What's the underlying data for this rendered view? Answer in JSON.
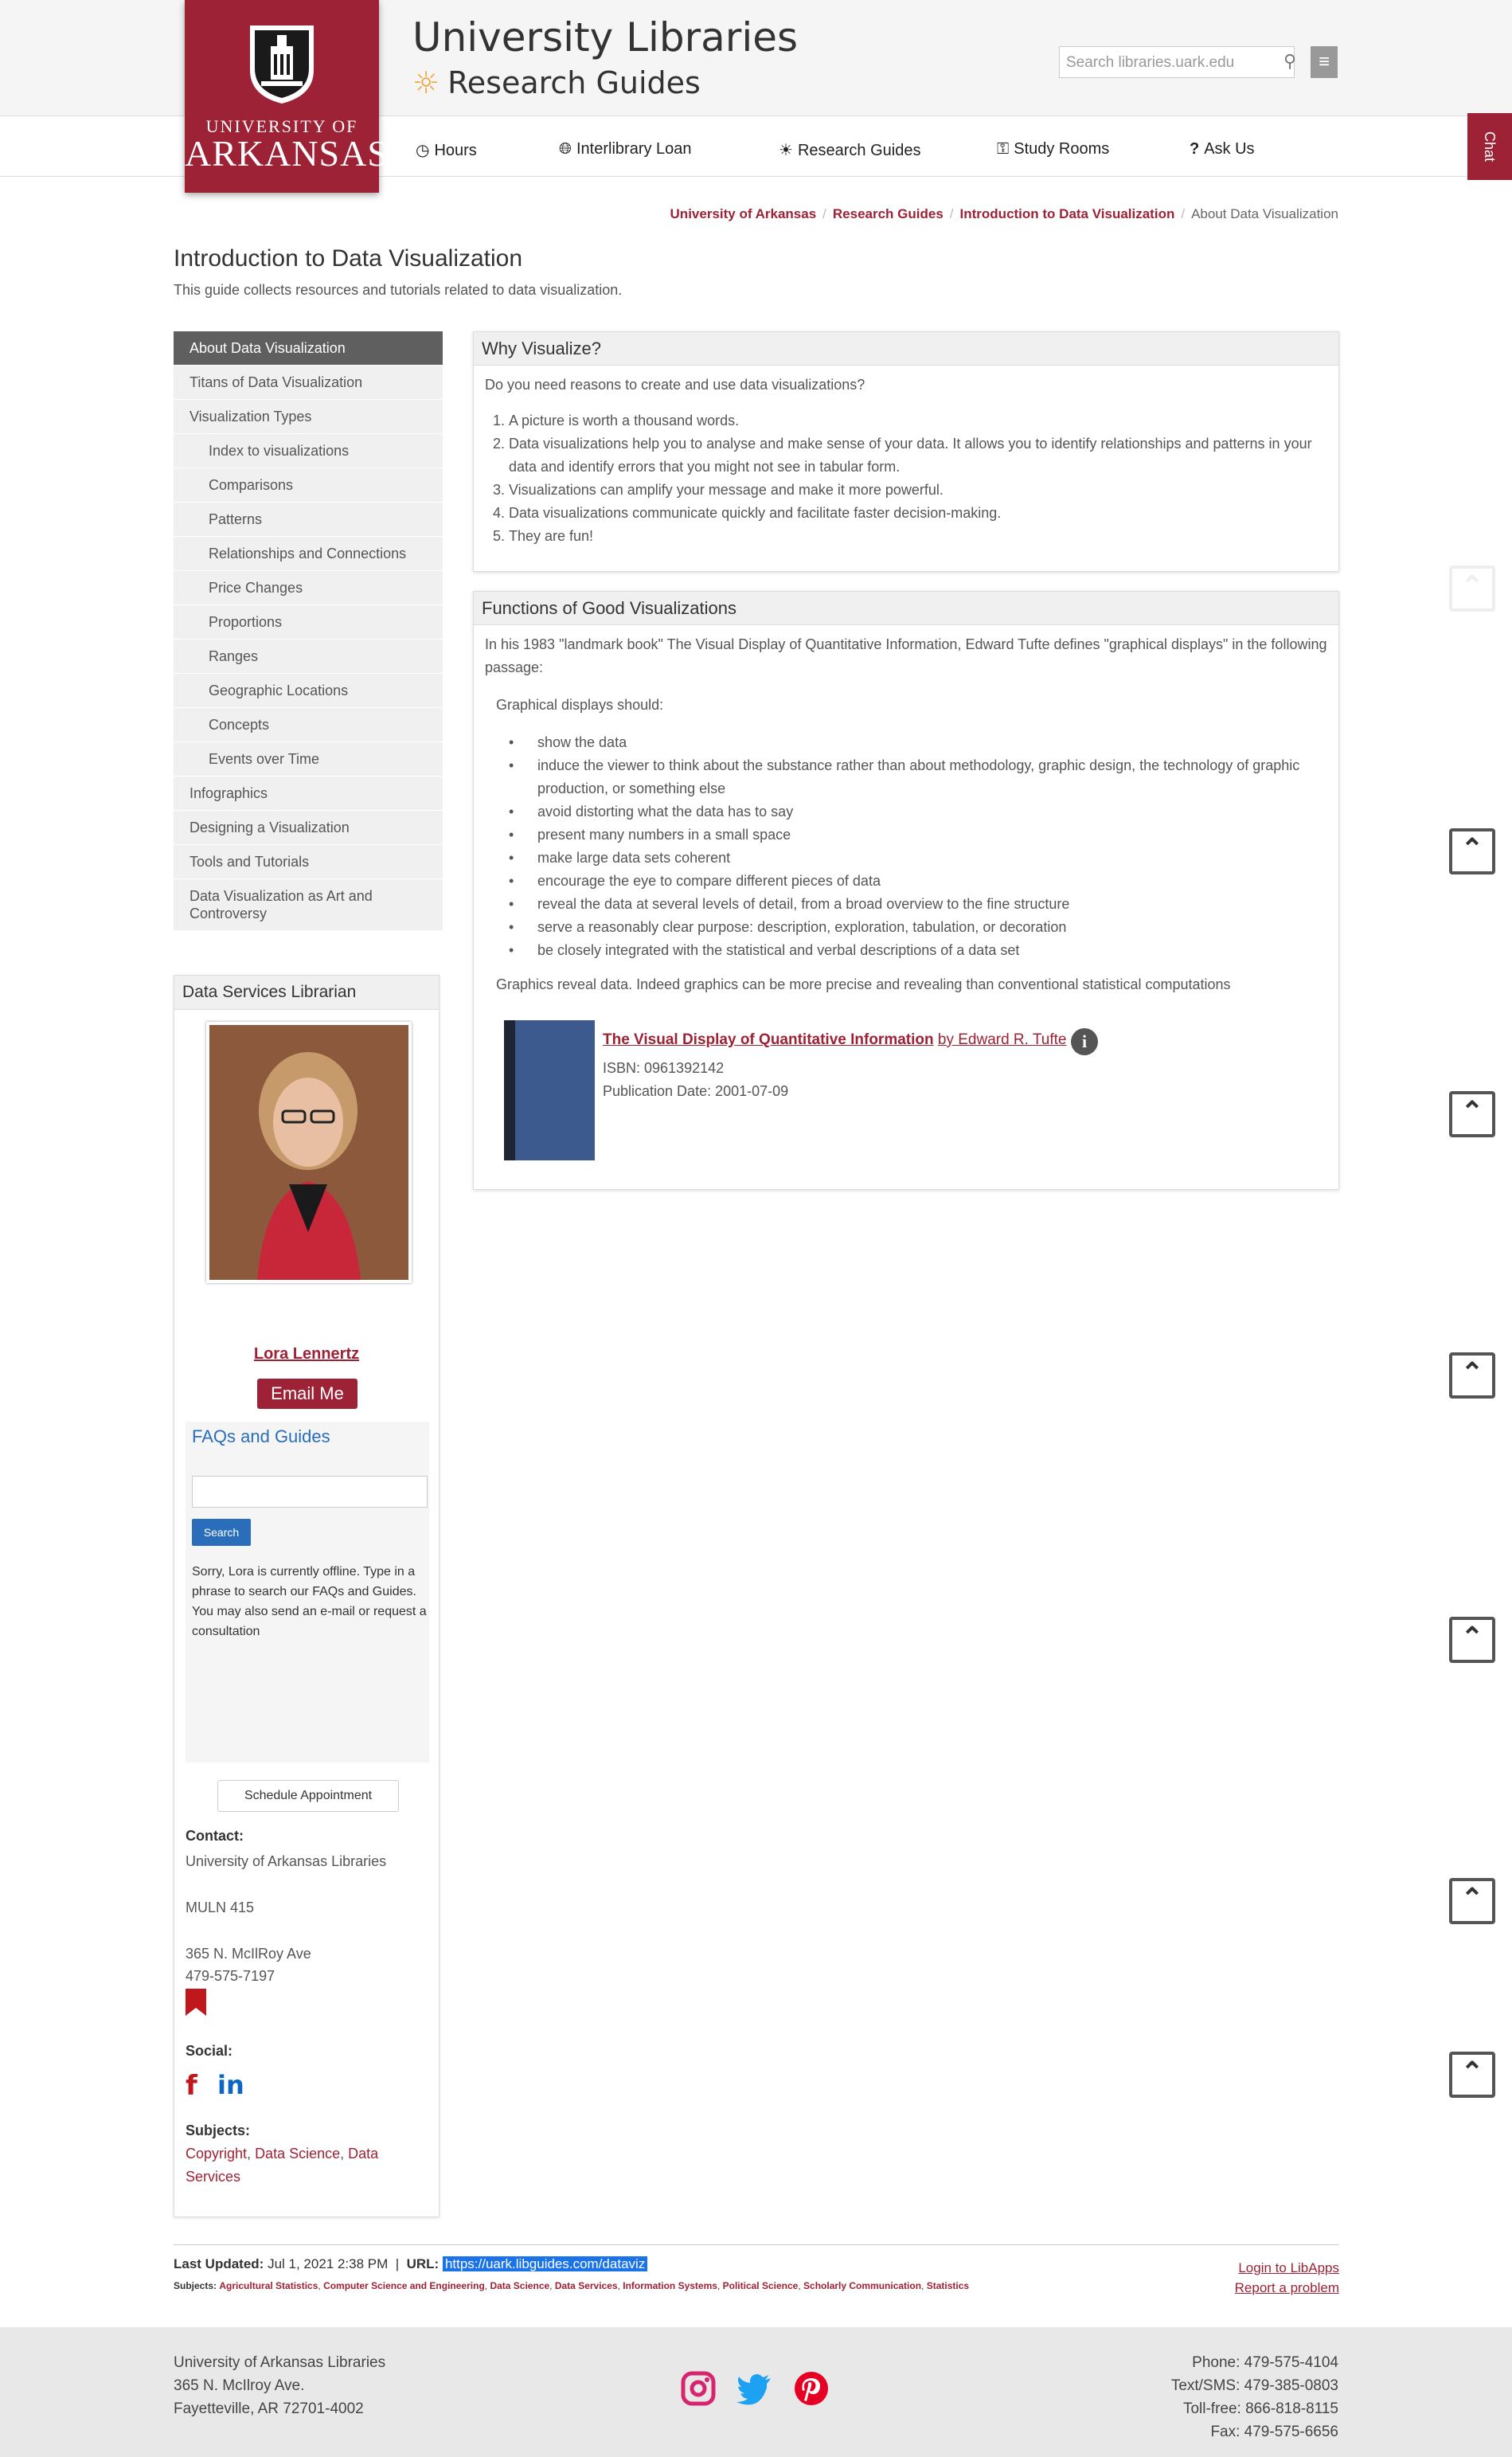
{
  "header": {
    "logo_university": "UNIVERSITY OF",
    "logo_arkansas": "ARKANSAS",
    "title": "University Libraries",
    "subtitle": "Research Guides",
    "search_placeholder": "Search libraries.uark.edu",
    "chat_label": "Chat",
    "nav": [
      {
        "label": "Hours",
        "icon": "clock-icon"
      },
      {
        "label": "Interlibrary Loan",
        "icon": "globe-icon"
      },
      {
        "label": "Research Guides",
        "icon": "sun-icon"
      },
      {
        "label": "Study Rooms",
        "icon": "key-icon"
      },
      {
        "label": "Ask Us",
        "icon": "question-icon"
      }
    ]
  },
  "breadcrumb": [
    "University of Arkansas",
    "Research Guides",
    "Introduction to Data Visualization",
    "About Data Visualization"
  ],
  "guide": {
    "title": "Introduction to Data Visualization",
    "description": "This guide collects resources and tutorials related to data visualization."
  },
  "sidenav": [
    {
      "label": "About Data Visualization",
      "active": true,
      "sub": false
    },
    {
      "label": "Titans of Data Visualization",
      "active": false,
      "sub": false
    },
    {
      "label": "Visualization Types",
      "active": false,
      "sub": false
    },
    {
      "label": "Index to visualizations",
      "active": false,
      "sub": true
    },
    {
      "label": "Comparisons",
      "active": false,
      "sub": true
    },
    {
      "label": "Patterns",
      "active": false,
      "sub": true
    },
    {
      "label": "Relationships and Connections",
      "active": false,
      "sub": true
    },
    {
      "label": "Price Changes",
      "active": false,
      "sub": true
    },
    {
      "label": "Proportions",
      "active": false,
      "sub": true
    },
    {
      "label": "Ranges",
      "active": false,
      "sub": true
    },
    {
      "label": "Geographic Locations",
      "active": false,
      "sub": true
    },
    {
      "label": "Concepts",
      "active": false,
      "sub": true
    },
    {
      "label": "Events over Time",
      "active": false,
      "sub": true
    },
    {
      "label": "Infographics",
      "active": false,
      "sub": false
    },
    {
      "label": "Designing a Visualization",
      "active": false,
      "sub": false
    },
    {
      "label": "Tools and Tutorials",
      "active": false,
      "sub": false
    },
    {
      "label": "Data Visualization as Art and Controversy",
      "active": false,
      "sub": false
    }
  ],
  "profile": {
    "heading": "Data Services Librarian",
    "name": "Lora Lennertz",
    "email_label": "Email Me",
    "faq_title": "FAQs and Guides",
    "faq_search_label": "Search",
    "faq_message": "Sorry, Lora is currently offline. Type in a phrase to search our FAQs and Guides. You may also send an e-mail or request a consultation",
    "schedule_label": "Schedule Appointment",
    "contact_label": "Contact:",
    "contact_org": "University of Arkansas Libraries",
    "contact_room": "MULN 415",
    "contact_street": "365 N. McIlRoy Ave",
    "contact_phone": "479-575-7197",
    "social_label": "Social:",
    "subjects_label": "Subjects:",
    "subjects": [
      "Copyright",
      "Data Science",
      "Data Services"
    ]
  },
  "why": {
    "heading": "Why Visualize?",
    "intro": "Do you need reasons to create and use data visualizations?",
    "items": [
      "A picture is worth a thousand words.",
      "Data visualizations help you to analyse and make sense of your data.  It allows you to identify relationships and patterns in your data and identify errors that you might not see in tabular form.",
      "Visualizations can amplify your message and make it more powerful.",
      "Data visualizations communicate quickly and facilitate faster decision-making.",
      "They are fun!"
    ]
  },
  "functions": {
    "heading": "Functions of Good Visualizations",
    "lead": "In his 1983 \"landmark book\" The Visual Display of Quantitative Information, Edward Tufte defines \"graphical displays\" in the following passage:",
    "should": "Graphical displays should:",
    "bullets": [
      "show the data",
      "induce the viewer to think about the substance rather than about methodology, graphic design, the technology of graphic production, or something else",
      "avoid distorting what the data has to say",
      "present many numbers in a small space",
      "make large data sets coherent",
      "encourage the eye to compare different pieces of data",
      "reveal the data at several levels of detail, from a broad overview to the fine structure",
      "serve a reasonably clear purpose: description, exploration, tabulation, or decoration",
      "be closely integrated with the statistical and verbal descriptions of a data set"
    ],
    "reveal": "Graphics reveal data. Indeed graphics can be more precise and revealing than conventional statistical computations",
    "book_title": "The Visual Display of Quantitative Information",
    "book_author": "by Edward R. Tufte",
    "book_isbn": "ISBN: 0961392142",
    "book_pub": "Publication Date: 2001-07-09"
  },
  "meta": {
    "updated_label": "Last Updated:",
    "updated_value": "Jul 1, 2021 2:38 PM",
    "url_label": "URL:",
    "url_value": "https://uark.libguides.com/dataviz",
    "subjects_label": "Subjects:",
    "subjects": [
      "Agricultural Statistics",
      "Computer Science and Engineering",
      "Data Science",
      "Data Services",
      "Information Systems",
      "Political Science",
      "Scholarly Communication",
      "Statistics"
    ],
    "login": "Login to LibApps",
    "report": "Report a problem"
  },
  "footer": {
    "org": "University of Arkansas Libraries",
    "street": "365 N. McIlroy Ave.",
    "city": "Fayetteville, AR 72701-4002",
    "phone": "Phone: 479-575-4104",
    "sms": "Text/SMS: 479-385-0803",
    "tollfree": "Toll-free: 866-818-8115",
    "fax": "Fax: 479-575-6656"
  },
  "colors": {
    "brand": "#9d2235",
    "faq_blue": "#2a6ebb",
    "sun": "#f0a742"
  }
}
